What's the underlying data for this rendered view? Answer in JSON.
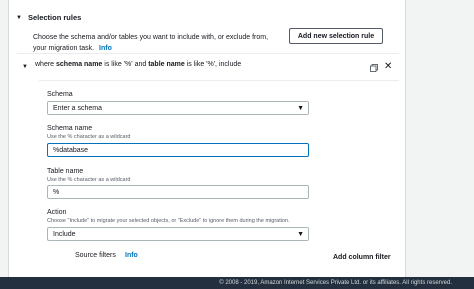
{
  "section": {
    "title": "Selection rules",
    "description": "Choose the schema and/or tables you want to include with, or exclude from, your migration task.",
    "info_link": "Info",
    "add_rule_button": "Add new selection rule"
  },
  "rule": {
    "summary_prefix": "where ",
    "summary_schema_bold": "schema name",
    "summary_mid1": " is like '%' and ",
    "summary_table_bold": "table name",
    "summary_mid2": " is like '%', include",
    "icons": {
      "copy": "copy-icon",
      "close": "close-icon"
    }
  },
  "form": {
    "schema_label": "Schema",
    "schema_value": "Enter a schema",
    "schema_name_label": "Schema name",
    "schema_name_hint": "Use the % character as a wildcard",
    "schema_name_value": "%database",
    "table_name_label": "Table name",
    "table_name_hint": "Use the % character as a wildcard",
    "table_name_value": "%",
    "action_label": "Action",
    "action_hint": "Choose \"Include\" to migrate your selected objects, or \"Exclude\" to ignore them during the migration.",
    "action_value": "Include"
  },
  "filters": {
    "source_filters_label": "Source filters",
    "info_link": "Info",
    "add_column_filter": "Add column filter"
  },
  "footer": {
    "copyright": "© 2008 - 2019, Amazon Internet Services Private Ltd. or its affiliates. All rights reserved."
  },
  "colors": {
    "link": "#0073bb",
    "focus": "#0073bb",
    "footer_bg": "#232f3e"
  }
}
